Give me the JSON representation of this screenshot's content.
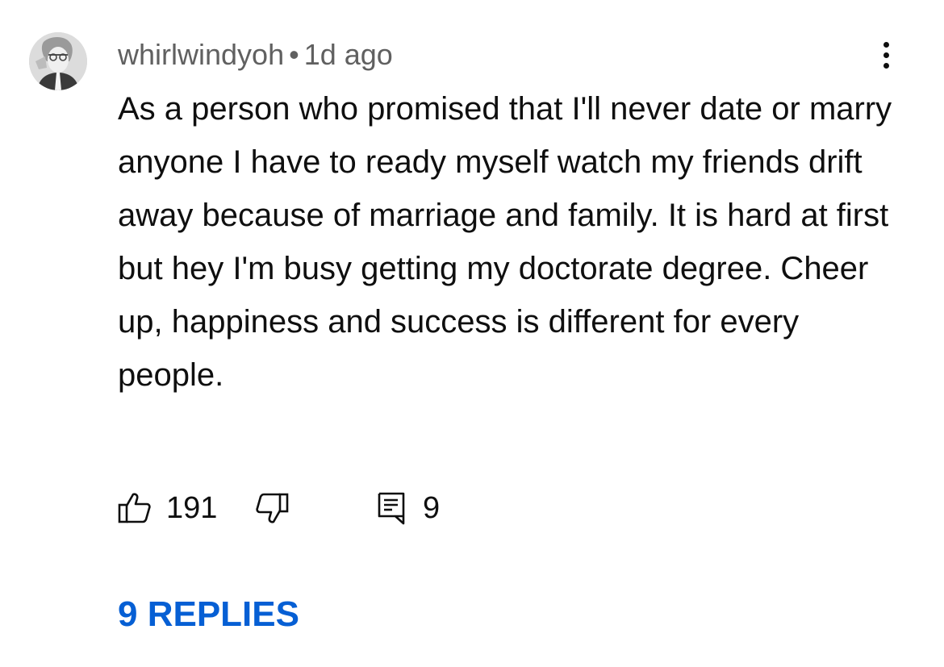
{
  "comment": {
    "author": "whirlwindyoh",
    "separator": "•",
    "time_ago": "1d ago",
    "text": "As a person who promised that I'll never date or marry anyone I have to ready myself watch my friends drift away because of marriage and family. It is hard at first but hey I'm busy getting my doctorate degree. Cheer up, happiness and success is different for every people.",
    "like_count": "191",
    "reply_count": "9",
    "replies_label": "9 REPLIES"
  },
  "icons": {
    "avatar": "avatar-illustration",
    "menu": "more-vertical-icon",
    "like": "thumbs-up-icon",
    "dislike": "thumbs-down-icon",
    "reply": "comment-icon"
  },
  "colors": {
    "text": "#0f0f0f",
    "meta": "#606060",
    "link": "#065fd4"
  }
}
